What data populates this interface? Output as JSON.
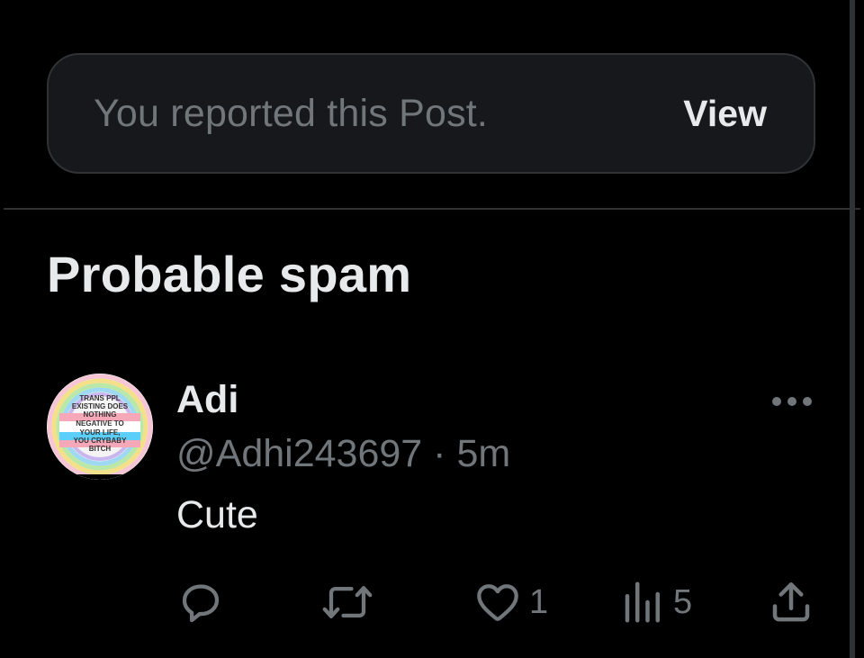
{
  "report_banner": {
    "text": "You reported this Post.",
    "view_label": "View"
  },
  "section": {
    "title": "Probable spam"
  },
  "post": {
    "author_name": "Adi",
    "handle": "@Adhi243697",
    "separator": "·",
    "time": "5m",
    "text": "Cute",
    "avatar_text": [
      "TRANS PPL",
      "EXISTING DOES",
      "NOTHING",
      "NEGATIVE TO",
      "YOUR LIFE,",
      "YOU CRYBABY",
      "BITCH"
    ],
    "actions": {
      "reply_icon": "reply-icon",
      "repost_icon": "repost-icon",
      "like_icon": "heart-icon",
      "like_count": "1",
      "views_icon": "views-icon",
      "views_count": "5",
      "share_icon": "share-icon"
    }
  },
  "colors": {
    "background": "#000000",
    "banner_bg": "#16181c",
    "border": "#2f3336",
    "primary_text": "#e7e9ea",
    "secondary_text": "#71767b"
  }
}
